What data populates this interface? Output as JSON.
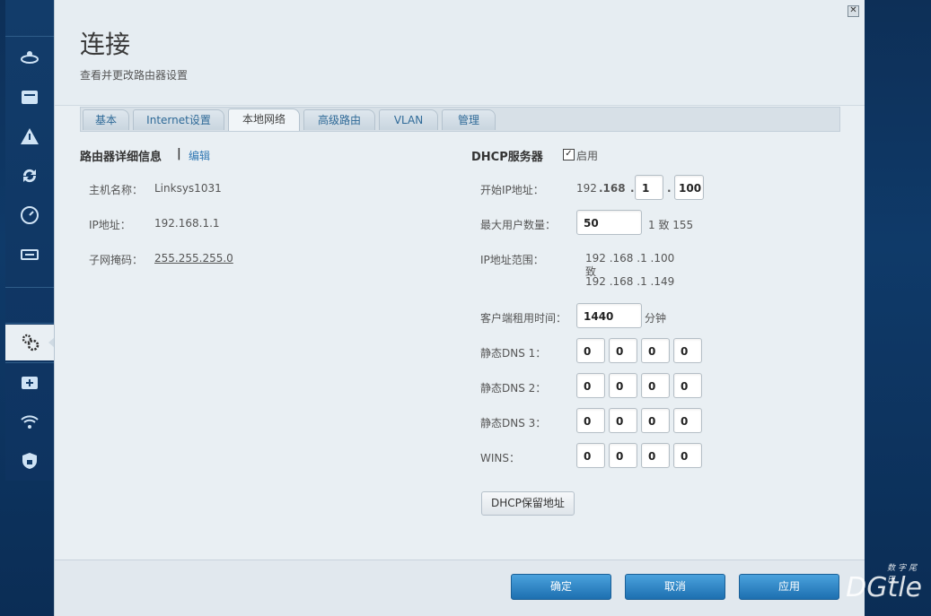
{
  "header": {
    "title": "连接",
    "subtitle": "查看并更改路由器设置",
    "close_glyph": "✕"
  },
  "tabs": [
    {
      "label": "基本"
    },
    {
      "label": "Internet设置"
    },
    {
      "label": "本地网络",
      "active": true
    },
    {
      "label": "高级路由"
    },
    {
      "label": "VLAN"
    },
    {
      "label": "管理"
    }
  ],
  "router": {
    "section_title": "路由器详细信息",
    "separator": "|",
    "edit_label": "编辑",
    "hostname_label": "主机名称：",
    "hostname": "Linksys1031",
    "ip_label": "IP地址：",
    "ip": "192.168.1.1",
    "mask_label": "子网掩码：",
    "mask": "255.255.255.0"
  },
  "dhcp": {
    "section_title": "DHCP服务器",
    "enable_label": "启用",
    "enable_glyph": "✓",
    "start_ip_label": "开始IP地址：",
    "start_ip_a": "192",
    "start_ip_b": ".168",
    "start_ip_dot1": ".",
    "start_ip_c": "1",
    "start_ip_dot2": ".",
    "start_ip_d": "100",
    "max_users_label": "最大用户数量：",
    "max_users": "50",
    "max_users_range": "1 致 155",
    "range_label": "IP地址范围：",
    "range_start": "192 .168 .1 .100",
    "range_to": "致",
    "range_end": "192 .168 .1 .149",
    "lease_label": "客户端租用时间：",
    "lease": "1440",
    "lease_unit": "分钟",
    "dns1_label": "静态DNS 1：",
    "dns1": [
      "0",
      "0",
      "0",
      "0"
    ],
    "dns2_label": "静态DNS 2：",
    "dns2": [
      "0",
      "0",
      "0",
      "0"
    ],
    "dns3_label": "静态DNS 3：",
    "dns3": [
      "0",
      "0",
      "0",
      "0"
    ],
    "wins_label": "WINS：",
    "wins": [
      "0",
      "0",
      "0",
      "0"
    ],
    "reservation_button": "DHCP保留地址"
  },
  "footer": {
    "ok": "确定",
    "cancel": "取消",
    "apply": "应用"
  },
  "watermark": {
    "brand": "DGtle",
    "tagline": "数字尾巴"
  },
  "sidebar_icons": [
    "router-icon",
    "calendar-icon",
    "warning-icon",
    "update-icon",
    "speed-icon",
    "usb-icon",
    "gear-icon",
    "medkit-icon",
    "wifi-settings-icon",
    "security-icon"
  ]
}
